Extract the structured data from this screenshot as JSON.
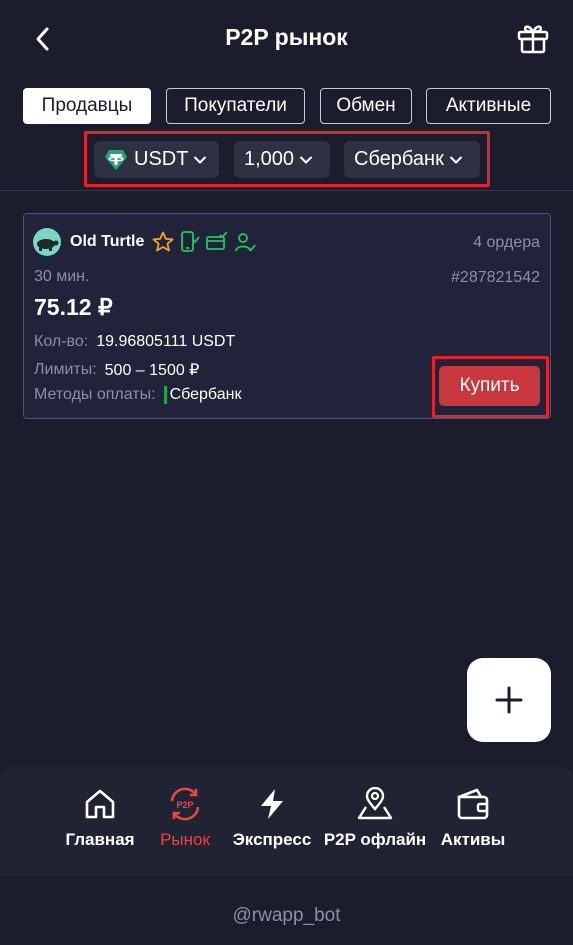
{
  "header": {
    "title": "P2P рынок",
    "back_icon": "chevron-left-icon",
    "gift_icon": "gift-icon"
  },
  "tabs": [
    {
      "label": "Продавцы",
      "active": true
    },
    {
      "label": "Покупатели",
      "active": false
    },
    {
      "label": "Обмен",
      "active": false
    },
    {
      "label": "Активные",
      "active": false
    }
  ],
  "filters": {
    "currency": "USDT",
    "amount": "1,000",
    "bank": "Сбербанк"
  },
  "offer": {
    "username": "Old Turtle",
    "orders": "4 ордера",
    "time": "30 мин.",
    "order_id": "#287821542",
    "price": "75.12 ₽",
    "quantity_label": "Кол-во:",
    "quantity_value": "19.96805111 USDT",
    "limits_label": "Лимиты:",
    "limits_value": "500 – 1500 ₽",
    "methods_label": "Методы оплаты:",
    "methods_value": "Сбербанк",
    "buy_label": "Купить"
  },
  "fab": {
    "icon": "plus-icon"
  },
  "nav": [
    {
      "label": "Главная",
      "icon": "home-icon",
      "active": false
    },
    {
      "label": "Рынок",
      "icon": "p2p-market-icon",
      "icon_text": "P2P",
      "active": true
    },
    {
      "label": "Экспресс",
      "icon": "lightning-icon",
      "active": false
    },
    {
      "label": "P2P офлайн",
      "icon": "map-pin-icon",
      "active": false
    },
    {
      "label": "Активы",
      "icon": "wallet-icon",
      "active": false
    }
  ],
  "footer": {
    "handle": "@rwapp_bot"
  },
  "colors": {
    "background": "#1b1d2c",
    "accent_red": "#e3222d",
    "buy_button": "#c8373e",
    "active_nav": "#e94545",
    "badge_green": "#22c55e",
    "star_orange": "#f5a524",
    "tether_green": "#26a17b"
  }
}
